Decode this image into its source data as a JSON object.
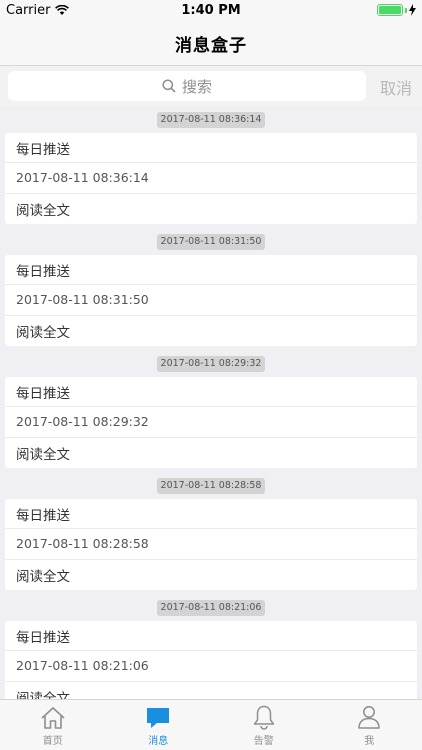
{
  "status": {
    "carrier": "Carrier",
    "time": "1:40 PM"
  },
  "nav": {
    "title": "消息盒子"
  },
  "search": {
    "placeholder": "搜索",
    "cancel": "取消"
  },
  "messages": [
    {
      "timestamp": "2017-08-11 08:36:14",
      "title": "每日推送",
      "time": "2017-08-11 08:36:14",
      "action": "阅读全文"
    },
    {
      "timestamp": "2017-08-11 08:31:50",
      "title": "每日推送",
      "time": "2017-08-11 08:31:50",
      "action": "阅读全文"
    },
    {
      "timestamp": "2017-08-11 08:29:32",
      "title": "每日推送",
      "time": "2017-08-11 08:29:32",
      "action": "阅读全文"
    },
    {
      "timestamp": "2017-08-11 08:28:58",
      "title": "每日推送",
      "time": "2017-08-11 08:28:58",
      "action": "阅读全文"
    },
    {
      "timestamp": "2017-08-11 08:21:06",
      "title": "每日推送",
      "time": "2017-08-11 08:21:06",
      "action": "阅读全文"
    }
  ],
  "tabs": [
    {
      "label": "首页",
      "icon": "home-icon"
    },
    {
      "label": "消息",
      "icon": "message-icon",
      "active": true
    },
    {
      "label": "告警",
      "icon": "bell-icon"
    },
    {
      "label": "我",
      "icon": "person-icon"
    }
  ],
  "colors": {
    "accent": "#1a8fe0",
    "battery": "#4cd964"
  }
}
